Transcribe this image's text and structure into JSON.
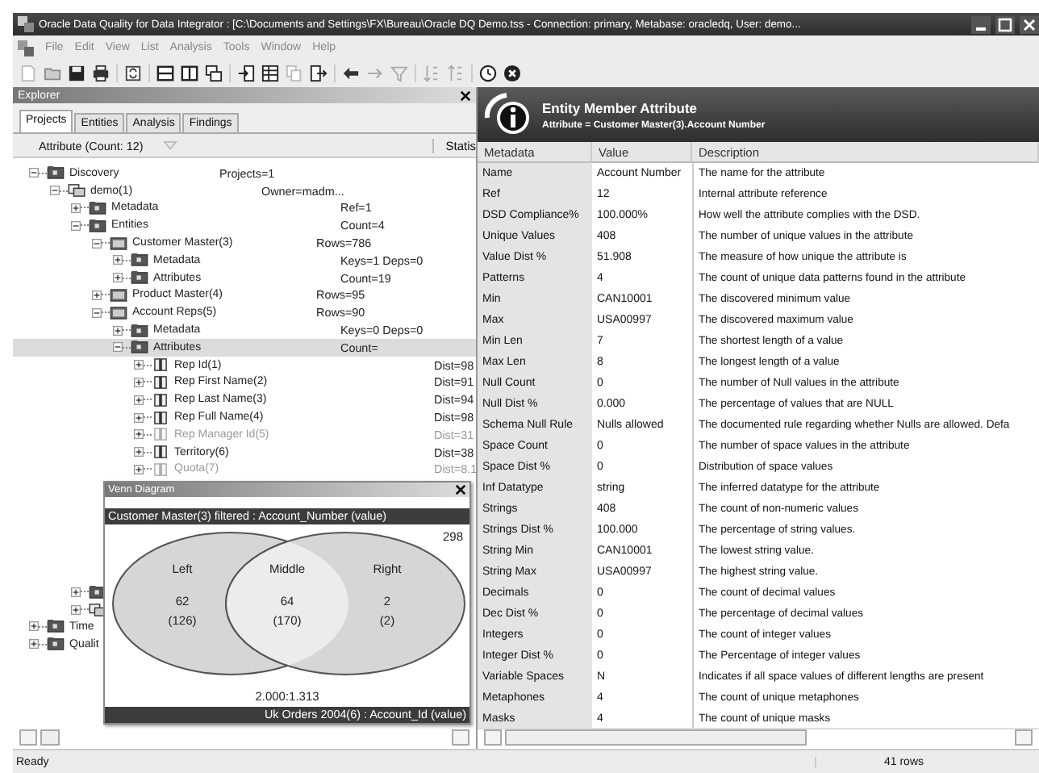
{
  "window": {
    "title": "Oracle Data Quality for Data Integrator : [C:\\Documents and Settings\\FX\\Bureau\\Oracle DQ Demo.tss - Connection: primary, Metabase: oracledq, User: demo..."
  },
  "menu": [
    "File",
    "Edit",
    "View",
    "List",
    "Analysis",
    "Tools",
    "Window",
    "Help"
  ],
  "explorer": {
    "title": "Explorer",
    "tabs": [
      {
        "label": "Projects",
        "selected": true
      },
      {
        "label": "Entities",
        "selected": false
      },
      {
        "label": "Analysis",
        "selected": false
      },
      {
        "label": "Findings",
        "selected": false
      }
    ],
    "column_1": "Attribute (Count: 12)",
    "column_2": "Statis",
    "tree": [
      {
        "label": "Discovery",
        "value": "Projects=1",
        "kind": "folder",
        "expanded": true,
        "selected": false,
        "disabled": false,
        "children": [
          {
            "label": "demo(1)",
            "value": "Owner=madm...",
            "kind": "project",
            "expanded": true,
            "selected": false,
            "disabled": false,
            "children": [
              {
                "label": "Metadata",
                "value": "Ref=1",
                "kind": "folder",
                "expanded": false,
                "selected": false,
                "disabled": false
              },
              {
                "label": "Entities",
                "value": "Count=4",
                "kind": "folder",
                "expanded": true,
                "selected": false,
                "disabled": false,
                "children": [
                  {
                    "label": "Customer Master(3)",
                    "value": "Rows=786",
                    "kind": "entity",
                    "expanded": true,
                    "selected": false,
                    "disabled": false,
                    "children": [
                      {
                        "label": "Metadata",
                        "value": "Keys=1 Deps=0",
                        "kind": "folder",
                        "expanded": false,
                        "selected": false,
                        "disabled": false
                      },
                      {
                        "label": "Attributes",
                        "value": "Count=19",
                        "kind": "folder",
                        "expanded": false,
                        "selected": false,
                        "disabled": false
                      }
                    ]
                  },
                  {
                    "label": "Product Master(4)",
                    "value": "Rows=95",
                    "kind": "entity",
                    "expanded": false,
                    "selected": false,
                    "disabled": false
                  },
                  {
                    "label": "Account Reps(5)",
                    "value": "Rows=90",
                    "kind": "entity",
                    "expanded": true,
                    "selected": false,
                    "disabled": false,
                    "children": [
                      {
                        "label": "Metadata",
                        "value": "Keys=0 Deps=0",
                        "kind": "folder",
                        "expanded": false,
                        "selected": false,
                        "disabled": false
                      },
                      {
                        "label": "Attributes",
                        "value": "Count=",
                        "kind": "folder",
                        "expanded": true,
                        "selected": true,
                        "disabled": false,
                        "children": [
                          {
                            "label": "Rep Id(1)",
                            "value": "Dist=98",
                            "kind": "attribute",
                            "expanded": false,
                            "selected": false,
                            "disabled": false
                          },
                          {
                            "label": "Rep First Name(2)",
                            "value": "Dist=91",
                            "kind": "attribute",
                            "expanded": false,
                            "selected": false,
                            "disabled": false
                          },
                          {
                            "label": "Rep Last Name(3)",
                            "value": "Dist=94",
                            "kind": "attribute",
                            "expanded": false,
                            "selected": false,
                            "disabled": false
                          },
                          {
                            "label": "Rep Full Name(4)",
                            "value": "Dist=98",
                            "kind": "attribute",
                            "expanded": false,
                            "selected": false,
                            "disabled": false
                          },
                          {
                            "label": "Rep Manager Id(5)",
                            "value": "Dist=31",
                            "kind": "attribute",
                            "expanded": false,
                            "selected": false,
                            "disabled": true
                          },
                          {
                            "label": "Territory(6)",
                            "value": "Dist=38",
                            "kind": "attribute",
                            "expanded": false,
                            "selected": false,
                            "disabled": false
                          },
                          {
                            "label": "Quota(7)",
                            "value": "Dist=8.1",
                            "kind": "attribute",
                            "expanded": false,
                            "selected": false,
                            "disabled": true
                          }
                        ]
                      }
                    ]
                  }
                ]
              },
              {
                "kind": "folder",
                "expanded": false,
                "selected": false,
                "disabled": false
              },
              {
                "kind": "project",
                "expanded": false,
                "selected": false,
                "disabled": false
              }
            ]
          }
        ]
      },
      {
        "label": "Time",
        "kind": "folder",
        "expanded": false,
        "selected": false,
        "disabled": false
      },
      {
        "label": "Qualit",
        "kind": "folder",
        "expanded": false,
        "selected": false,
        "disabled": false
      }
    ]
  },
  "venn": {
    "title": "Venn Diagram",
    "top_label": "Customer Master(3) filtered : Account_Number (value)",
    "count": "298",
    "left": {
      "label": "Left",
      "count": "62",
      "total": "(126)"
    },
    "middle": {
      "label": "Middle",
      "count": "64",
      "total": "(170)"
    },
    "right": {
      "label": "Right",
      "count": "2",
      "total": "(2)"
    },
    "ratio": "2.000:1.313",
    "bottom_label": "Uk Orders 2004(6) : Account_Id (value)"
  },
  "attribute_panel": {
    "title": "Entity Member Attribute",
    "subtitle": "Attribute = Customer Master(3).Account Number",
    "columns": [
      "Metadata",
      "Value",
      "Description"
    ],
    "rows": [
      {
        "metadata": "Name",
        "value": "Account Number",
        "description": "The name for the attribute"
      },
      {
        "metadata": "Ref",
        "value": "12",
        "description": "Internal attribute reference"
      },
      {
        "metadata": "DSD Compliance%",
        "value": "100.000%",
        "description": "How well the attribute complies with the DSD."
      },
      {
        "metadata": "Unique Values",
        "value": "408",
        "description": "The number of unique values in the attribute"
      },
      {
        "metadata": "Value Dist %",
        "value": "51.908",
        "description": "The measure of how unique the attribute is"
      },
      {
        "metadata": "Patterns",
        "value": "4",
        "description": "The count of unique data patterns found in the attribute"
      },
      {
        "metadata": "Min",
        "value": "CAN10001",
        "description": "The discovered minimum value"
      },
      {
        "metadata": "Max",
        "value": "USA00997",
        "description": "The discovered maximum value"
      },
      {
        "metadata": "Min Len",
        "value": "7",
        "description": "The shortest length of a value"
      },
      {
        "metadata": "Max Len",
        "value": "8",
        "description": "The longest length of a value"
      },
      {
        "metadata": "Null Count",
        "value": "0",
        "description": "The number of Null values in the attribute"
      },
      {
        "metadata": "Null Dist %",
        "value": "0.000",
        "description": "The percentage of values that are NULL"
      },
      {
        "metadata": "Schema Null Rule",
        "value": "Nulls allowed",
        "description": "The documented rule regarding whether Nulls are allowed. Defa"
      },
      {
        "metadata": "Space Count",
        "value": "0",
        "description": "The number of space values in the attribute"
      },
      {
        "metadata": "Space Dist %",
        "value": "0",
        "description": "Distribution of space values"
      },
      {
        "metadata": "Inf Datatype",
        "value": "string",
        "description": "The inferred datatype for the attribute"
      },
      {
        "metadata": "Strings",
        "value": "408",
        "description": "The count of non-numeric values"
      },
      {
        "metadata": "Strings Dist %",
        "value": "100.000",
        "description": "The percentage of string values."
      },
      {
        "metadata": "String Min",
        "value": "CAN10001",
        "description": "The lowest string value."
      },
      {
        "metadata": "String Max",
        "value": "USA00997",
        "description": "The highest string value."
      },
      {
        "metadata": "Decimals",
        "value": "0",
        "description": "The count of decimal values"
      },
      {
        "metadata": "Dec Dist %",
        "value": "0",
        "description": "The percentage of decimal values"
      },
      {
        "metadata": "Integers",
        "value": "0",
        "description": "The count of integer values"
      },
      {
        "metadata": "Integer Dist %",
        "value": "0",
        "description": "The Percentage of integer values"
      },
      {
        "metadata": "Variable Spaces",
        "value": "N",
        "description": "Indicates if all space values of different lengths are present"
      },
      {
        "metadata": "Metaphones",
        "value": "4",
        "description": "The count of unique metaphones"
      },
      {
        "metadata": "Masks",
        "value": "4",
        "description": "The count of unique masks"
      }
    ]
  },
  "status_bar": {
    "message": "Ready",
    "rows": "41 rows"
  }
}
